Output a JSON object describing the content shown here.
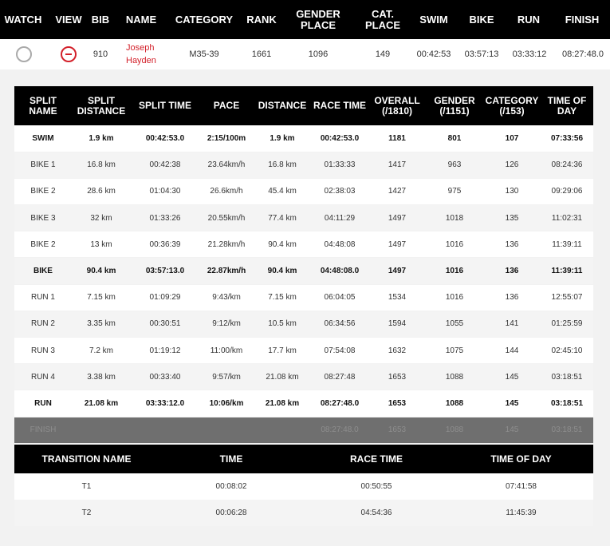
{
  "header": {
    "watch": "WATCH",
    "view": "VIEW",
    "bib": "BIB",
    "name": "NAME",
    "category": "CATEGORY",
    "rank": "RANK",
    "gender_place": "GENDER PLACE",
    "cat_place": "CAT. PLACE",
    "swim": "SWIM",
    "bike": "BIKE",
    "run": "RUN",
    "finish": "FINISH"
  },
  "athlete": {
    "bib": "910",
    "first_name": "Joseph",
    "last_name": "Hayden",
    "category": "M35-39",
    "rank": "1661",
    "gender_place": "1096",
    "cat_place": "149",
    "swim": "00:42:53",
    "bike": "03:57:13",
    "run": "03:33:12",
    "finish": "08:27:48.0"
  },
  "splits": {
    "headers": [
      "SPLIT NAME",
      "SPLIT DISTANCE",
      "SPLIT TIME",
      "PACE",
      "DISTANCE",
      "RACE TIME",
      "OVERALL (/1810)",
      "GENDER (/1151)",
      "CATEGORY (/153)",
      "TIME OF DAY"
    ],
    "rows": [
      {
        "style": "row-white bold",
        "cells": [
          "SWIM",
          "1.9 km",
          "00:42:53.0",
          "2:15/100m",
          "1.9 km",
          "00:42:53.0",
          "1181",
          "801",
          "107",
          "07:33:56"
        ]
      },
      {
        "style": "row-grey",
        "cells": [
          "BIKE 1",
          "16.8 km",
          "00:42:38",
          "23.64km/h",
          "16.8 km",
          "01:33:33",
          "1417",
          "963",
          "126",
          "08:24:36"
        ]
      },
      {
        "style": "row-white",
        "cells": [
          "BIKE 2",
          "28.6 km",
          "01:04:30",
          "26.6km/h",
          "45.4 km",
          "02:38:03",
          "1427",
          "975",
          "130",
          "09:29:06"
        ]
      },
      {
        "style": "row-grey",
        "cells": [
          "BIKE 3",
          "32 km",
          "01:33:26",
          "20.55km/h",
          "77.4 km",
          "04:11:29",
          "1497",
          "1018",
          "135",
          "11:02:31"
        ]
      },
      {
        "style": "row-white",
        "cells": [
          "BIKE 2",
          "13 km",
          "00:36:39",
          "21.28km/h",
          "90.4 km",
          "04:48:08",
          "1497",
          "1016",
          "136",
          "11:39:11"
        ]
      },
      {
        "style": "row-grey bold",
        "cells": [
          "BIKE",
          "90.4 km",
          "03:57:13.0",
          "22.87km/h",
          "90.4 km",
          "04:48:08.0",
          "1497",
          "1016",
          "136",
          "11:39:11"
        ]
      },
      {
        "style": "row-white",
        "cells": [
          "RUN 1",
          "7.15 km",
          "01:09:29",
          "9:43/km",
          "7.15 km",
          "06:04:05",
          "1534",
          "1016",
          "136",
          "12:55:07"
        ]
      },
      {
        "style": "row-grey",
        "cells": [
          "RUN 2",
          "3.35 km",
          "00:30:51",
          "9:12/km",
          "10.5 km",
          "06:34:56",
          "1594",
          "1055",
          "141",
          "01:25:59"
        ]
      },
      {
        "style": "row-white",
        "cells": [
          "RUN 3",
          "7.2 km",
          "01:19:12",
          "11:00/km",
          "17.7 km",
          "07:54:08",
          "1632",
          "1075",
          "144",
          "02:45:10"
        ]
      },
      {
        "style": "row-grey",
        "cells": [
          "RUN 4",
          "3.38 km",
          "00:33:40",
          "9:57/km",
          "21.08 km",
          "08:27:48",
          "1653",
          "1088",
          "145",
          "03:18:51"
        ]
      },
      {
        "style": "row-white bold",
        "cells": [
          "RUN",
          "21.08 km",
          "03:33:12.0",
          "10:06/km",
          "21.08 km",
          "08:27:48.0",
          "1653",
          "1088",
          "145",
          "03:18:51"
        ]
      },
      {
        "style": "finish",
        "cells": [
          "FINISH",
          "",
          "",
          "",
          "",
          "08:27:48.0",
          "1653",
          "1088",
          "145",
          "03:18:51"
        ]
      }
    ]
  },
  "transitions": {
    "headers": [
      "TRANSITION NAME",
      "TIME",
      "RACE TIME",
      "TIME OF DAY"
    ],
    "rows": [
      {
        "style": "row-white",
        "cells": [
          "T1",
          "00:08:02",
          "00:50:55",
          "07:41:58"
        ]
      },
      {
        "style": "row-grey",
        "cells": [
          "T2",
          "00:06:28",
          "04:54:36",
          "11:45:39"
        ]
      }
    ]
  },
  "colors": {
    "header_bg": "#000000",
    "accent_red": "#d3202a",
    "finish_row_bg": "#6f6f6f",
    "panel_bg": "#f2f2f2"
  }
}
